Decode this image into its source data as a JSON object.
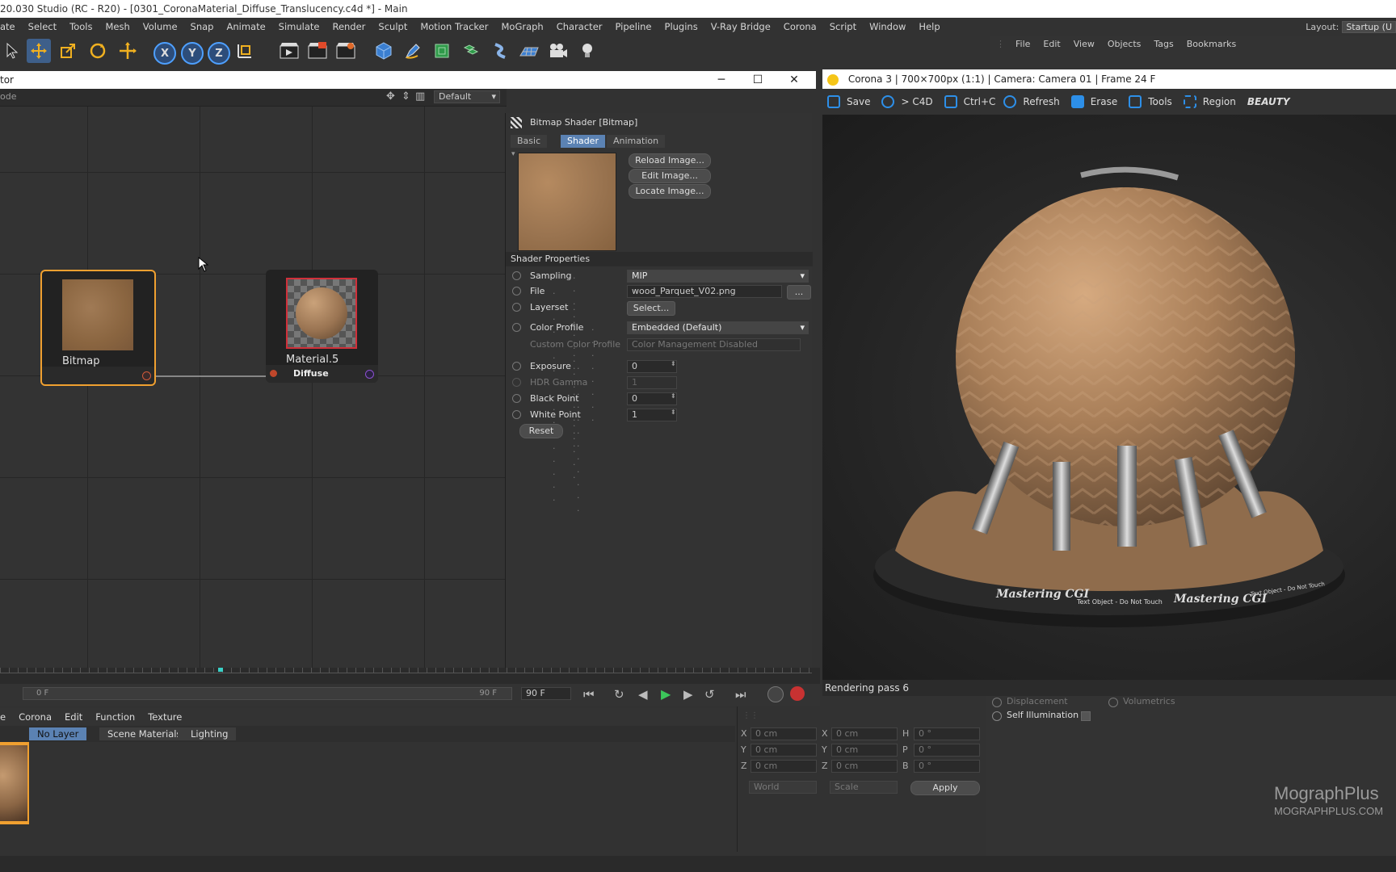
{
  "app": {
    "title": "20.030 Studio (RC - R20) - [0301_CoronaMaterial_Diffuse_Translucency.c4d *] - Main",
    "layout_label": "Layout:",
    "layout_value": "Startup (U"
  },
  "menu": [
    "ate",
    "Select",
    "Tools",
    "Mesh",
    "Volume",
    "Snap",
    "Animate",
    "Simulate",
    "Render",
    "Sculpt",
    "Motion Tracker",
    "MoGraph",
    "Character",
    "Pipeline",
    "Plugins",
    "V-Ray Bridge",
    "Corona",
    "Script",
    "Window",
    "Help"
  ],
  "toolbar": {
    "x": "X",
    "y": "Y",
    "z": "Z"
  },
  "objmgr": {
    "menu": [
      "File",
      "Edit",
      "View",
      "Objects",
      "Tags",
      "Bookmarks"
    ]
  },
  "node_editor": {
    "title": "tor",
    "mode_label": "ode",
    "preset": "Default",
    "nodes": {
      "bitmap": {
        "label": "Bitmap"
      },
      "material": {
        "label": "Material.5",
        "port": "Diffuse"
      }
    }
  },
  "attr": {
    "header": "Bitmap Shader [Bitmap]",
    "tabs": [
      "Basic",
      "Shader",
      "Animation"
    ],
    "buttons": {
      "reload": "Reload Image...",
      "edit": "Edit Image...",
      "locate": "Locate Image..."
    },
    "section": "Shader Properties",
    "sampling": {
      "label": "Sampling",
      "value": "MIP"
    },
    "file": {
      "label": "File",
      "value": "wood_Parquet_V02.png",
      "more": "..."
    },
    "layerset": {
      "label": "Layerset",
      "value": "Select..."
    },
    "color_profile": {
      "label": "Color Profile",
      "value": "Embedded (Default)"
    },
    "custom_color_profile": {
      "label": "Custom Color Profile",
      "value": "Color Management Disabled"
    },
    "exposure": {
      "label": "Exposure",
      "value": "0"
    },
    "hdr_gamma": {
      "label": "HDR Gamma",
      "value": "1"
    },
    "black_point": {
      "label": "Black Point",
      "value": "0"
    },
    "white_point": {
      "label": "White Point",
      "value": "1"
    },
    "reset": "Reset"
  },
  "vfb": {
    "title": "Corona 3 | 700×700px (1:1) | Camera: Camera 01 | Frame 24 F",
    "save": "Save",
    "to_c4d": "> C4D",
    "ctrl_c": "Ctrl+C",
    "refresh": "Refresh",
    "erase": "Erase",
    "tools": "Tools",
    "region": "Region",
    "pass": "BEAUTY",
    "status": "Rendering pass 6",
    "base_text": [
      "Mastering CGI",
      "Text Object - Do Not Touch",
      "Mastering CGI",
      "Text Object - Do Not Touch"
    ]
  },
  "timeline": {
    "start": "0 F",
    "end_slider": "90 F",
    "end_field": "90 F"
  },
  "matmgr": {
    "menu": [
      "e",
      "Corona",
      "Edit",
      "Function",
      "Texture"
    ],
    "filters": [
      "No Layer",
      "Scene Materials",
      "Lighting"
    ]
  },
  "coords": {
    "rows": [
      {
        "a": "X",
        "av": "0 cm",
        "b": "X",
        "bv": "0 cm",
        "c": "H",
        "cv": "0 °"
      },
      {
        "a": "Y",
        "av": "0 cm",
        "b": "Y",
        "bv": "0 cm",
        "c": "P",
        "cv": "0 °"
      },
      {
        "a": "Z",
        "av": "0 cm",
        "b": "Z",
        "bv": "0 cm",
        "c": "B",
        "cv": "0 °"
      }
    ],
    "world": "World",
    "scale": "Scale",
    "apply": "Apply"
  },
  "material_panel": {
    "displacement": "Displacement",
    "volumetrics": "Volumetrics",
    "self_illumination": "Self Illumination"
  },
  "watermark": {
    "line1_a": "Mograph",
    "line1_b": "Plus",
    "line2": "MOGRAPHPLUS.COM"
  },
  "colors": {
    "accent": "#5b82b3",
    "node_selected": "#f0a030",
    "port_red": "#c0472b",
    "port_purple": "#8c4fd0"
  }
}
